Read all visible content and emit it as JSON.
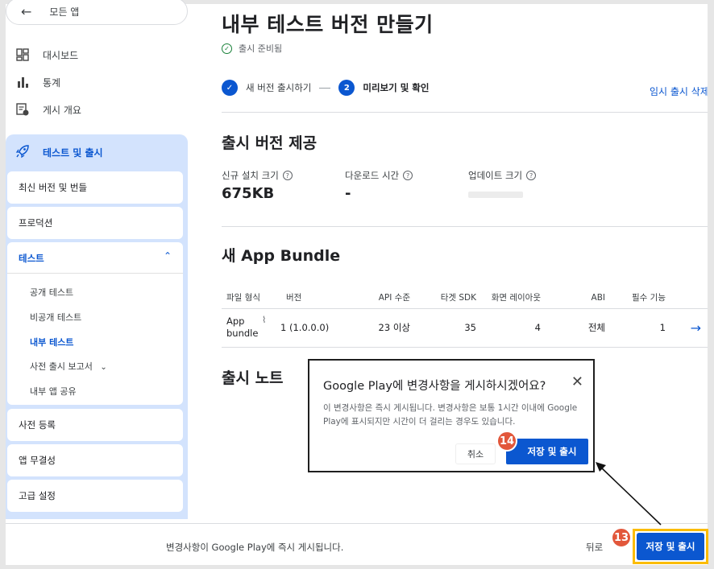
{
  "sidebar": {
    "back_label": "모든 앱",
    "items": [
      {
        "label": "대시보드",
        "icon": "dashboard-icon"
      },
      {
        "label": "통계",
        "icon": "bar-chart-icon"
      },
      {
        "label": "게시 개요",
        "icon": "publishing-overview-icon"
      }
    ],
    "group": {
      "label": "테스트 및 출시",
      "icon": "rocket-icon",
      "latest": "최신 버전 및 번들",
      "production": "프로덕션",
      "testing": {
        "label": "테스트",
        "subitems": [
          "공개 테스트",
          "비공개 테스트",
          "내부 테스트",
          "사전 출시 보고서",
          "내부 앱 공유"
        ]
      },
      "pre_registration": "사전 등록",
      "app_integrity": "앱 무결성",
      "advanced": "고급 설정"
    }
  },
  "main": {
    "title": "내부 테스트 버전 만들기",
    "status": "출시 준비됨",
    "stepper": {
      "step1": "새 버전 출시하기",
      "step2_num": "2",
      "step2": "미리보기 및 확인"
    },
    "discard_link": "임시 출시 삭제",
    "release_section": {
      "title": "출시 버전 제공",
      "new_install_label": "신규 설치 크기",
      "new_install_value": "675KB",
      "download_time_label": "다운로드 시간",
      "download_time_value": "-",
      "update_size_label": "업데이트 크기"
    },
    "bundle_section": {
      "title": "새 App Bundle",
      "columns": [
        "파일 형식",
        "버전",
        "API 수준",
        "타겟 SDK",
        "화면 레이아웃",
        "ABI",
        "필수 기능"
      ],
      "row": {
        "type_line1": "App",
        "type_line2": "bundle",
        "version": "1 (1.0.0.0)",
        "api": "23 이상",
        "target_sdk": "35",
        "layouts": "4",
        "abi": "전체",
        "features": "1"
      }
    },
    "notes_title": "출시 노트"
  },
  "bottom_bar": {
    "message": "변경사항이 Google Play에 즉시 게시됩니다.",
    "back": "뒤로",
    "save": "저장 및 출시",
    "badge": "13"
  },
  "dialog": {
    "title": "Google Play에 변경사항을 게시하시겠어요?",
    "body": "이 변경사항은 즉시 게시됩니다. 변경사항은 보통 1시간 이내에 Google Play에 표시되지만 시간이 더 걸리는 경우도 있습니다.",
    "cancel": "취소",
    "save": "저장 및 출시",
    "badge": "14"
  },
  "colors": {
    "accent": "#0b57d0",
    "nav_group_bg": "#d3e3fd",
    "badge": "#e2573b",
    "highlight": "#fbbc04"
  }
}
